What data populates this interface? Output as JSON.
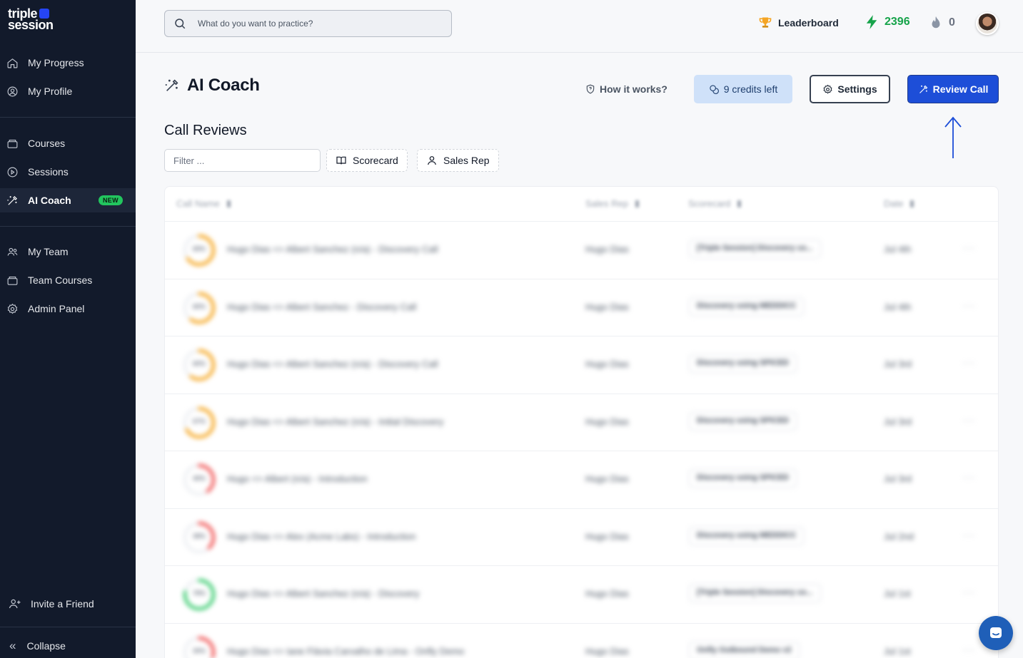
{
  "brand": {
    "line1": "triple",
    "line2": "session"
  },
  "sidebar": {
    "items": [
      {
        "label": "My Progress"
      },
      {
        "label": "My Profile"
      },
      {
        "label": "Courses"
      },
      {
        "label": "Sessions"
      },
      {
        "label": "AI Coach",
        "badge": "NEW"
      },
      {
        "label": "My Team"
      },
      {
        "label": "Team Courses"
      },
      {
        "label": "Admin Panel"
      }
    ],
    "invite": "Invite a Friend",
    "collapse": "Collapse"
  },
  "topbar": {
    "search_placeholder": "What do you want to practice?",
    "leaderboard": "Leaderboard",
    "xp": "2396",
    "streak": "0"
  },
  "page": {
    "title": "AI Coach",
    "how_it_works": "How it works?",
    "credits": "9 credits left",
    "settings": "Settings",
    "review_call": "Review Call",
    "section_title": "Call Reviews",
    "filter_placeholder": "Filter ...",
    "chip_scorecard": "Scorecard",
    "chip_sales_rep": "Sales Rep"
  },
  "table": {
    "headers": [
      "Call Name",
      "Sales Rep",
      "Scorecard",
      "Date"
    ],
    "rows": [
      {
        "score": "65%",
        "score_value": 65,
        "color": "#f59e0b",
        "name": "Hugo Dias <> Albert Sanchez (n/a) - Discovery Call",
        "rep": "Hugo Dias",
        "scorecard": "[Triple Session] Discovery us...",
        "date": "Jul 4th",
        "more": "···"
      },
      {
        "score": "60%",
        "score_value": 60,
        "color": "#f59e0b",
        "name": "Hugo Dias <> Albert Sanchez - Discovery Call",
        "rep": "Hugo Dias",
        "scorecard": "Discovery using MEDDICC",
        "date": "Jul 4th",
        "more": "···"
      },
      {
        "score": "60%",
        "score_value": 60,
        "color": "#f59e0b",
        "name": "Hugo Dias <> Albert Sanchez (n/a) - Discovery Call",
        "rep": "Hugo Dias",
        "scorecard": "Discovery using SPICED",
        "date": "Jul 3rd",
        "more": "···"
      },
      {
        "score": "67%",
        "score_value": 67,
        "color": "#f59e0b",
        "name": "Hugo Dias <> Albert Sanchez (n/a) - Initial Discovery",
        "rep": "Hugo Dias",
        "scorecard": "Discovery using SPICED",
        "date": "Jul 3rd",
        "more": "···"
      },
      {
        "score": "40%",
        "score_value": 40,
        "color": "#ef4444",
        "name": "Hugo <> Albert (n/a) - Introduction",
        "rep": "Hugo Dias",
        "scorecard": "Discovery using SPICED",
        "date": "Jul 3rd",
        "more": "···"
      },
      {
        "score": "38%",
        "score_value": 38,
        "color": "#ef4444",
        "name": "Hugo Dias <> Alex (Acme Labs) - Introduction",
        "rep": "Hugo Dias",
        "scorecard": "Discovery using MEDDICC",
        "date": "Jul 2nd",
        "more": "···"
      },
      {
        "score": "78%",
        "score_value": 78,
        "color": "#22c55e",
        "name": "Hugo Dias <> Albert Sanchez (n/a) - Discovery",
        "rep": "Hugo Dias",
        "scorecard": "[Triple Session] Discovery us...",
        "date": "Jul 1st",
        "more": "···"
      },
      {
        "score": "30%",
        "score_value": 30,
        "color": "#ef4444",
        "name": "Hugo Dias <> Iane Flávia Carvalho de Lima - Onfly Demo",
        "rep": "Hugo Dias",
        "scorecard": "Onfly Outbound Demo v2",
        "date": "Jul 1st",
        "more": "···"
      }
    ]
  },
  "colors": {
    "sidebar_bg": "#121a2b",
    "accent": "#1d4ed8",
    "new_badge": "#22c55e",
    "xp": "#16a34a"
  }
}
